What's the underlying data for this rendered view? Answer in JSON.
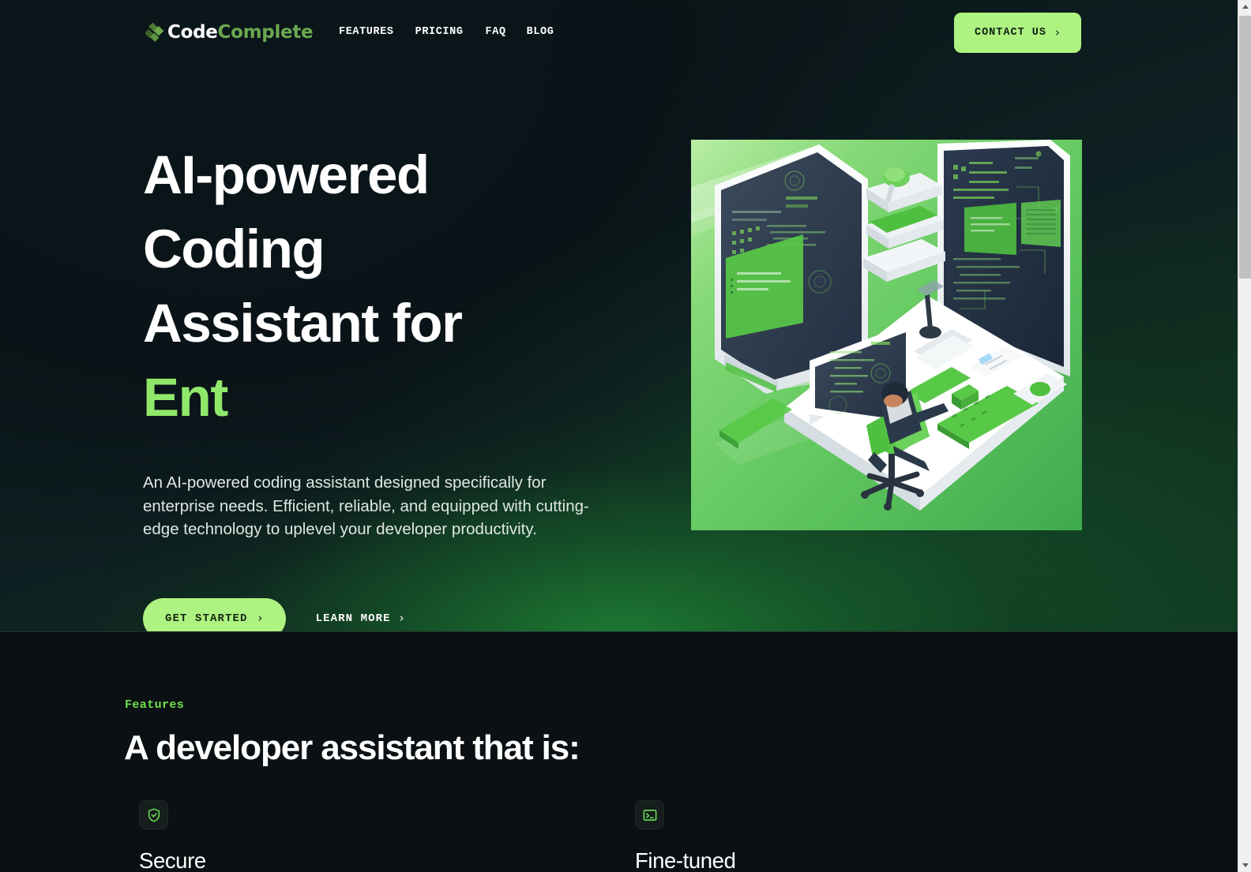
{
  "nav": {
    "brand_primary": "Code",
    "brand_secondary": "Complete",
    "brand_mark_icon": "codecomplete-logo-icon",
    "links": [
      {
        "label": "FEATURES"
      },
      {
        "label": "PRICING"
      },
      {
        "label": "FAQ"
      },
      {
        "label": "BLOG"
      }
    ],
    "contact_label": "CONTACT US",
    "contact_chevron": "›"
  },
  "hero": {
    "headline_line1": "AI-powered Coding",
    "headline_line2": "Assistant for",
    "headline_line3_accent": "Ent",
    "subcopy": "An AI-powered coding assistant designed specifically for enterprise needs. Efficient, reliable, and equipped with cutting-edge technology to uplevel your developer productivity.",
    "primary_cta": "GET STARTED",
    "primary_cta_chevron": "›",
    "secondary_cta": "LEARN MORE",
    "secondary_cta_chevron": "›",
    "illustration_name": "isometric-developer-workstation-illustration"
  },
  "features": {
    "eyebrow": "Features",
    "title": "A developer assistant that is:",
    "items": [
      {
        "icon": "shield-check-icon",
        "name": "Secure"
      },
      {
        "icon": "terminal-icon",
        "name": "Fine-tuned"
      }
    ]
  },
  "scrollbar": {
    "up_arrow_icon": "scroll-up-arrow-icon",
    "down_arrow_icon": "scroll-down-arrow-icon"
  },
  "colors": {
    "accent_green": "#aef281",
    "bright_green": "#72e24b",
    "logo_green": "#6aa84f",
    "hero_bg_dark": "#0c171a",
    "hero_bg_green": "#123c22",
    "features_bg": "#0a1013"
  }
}
